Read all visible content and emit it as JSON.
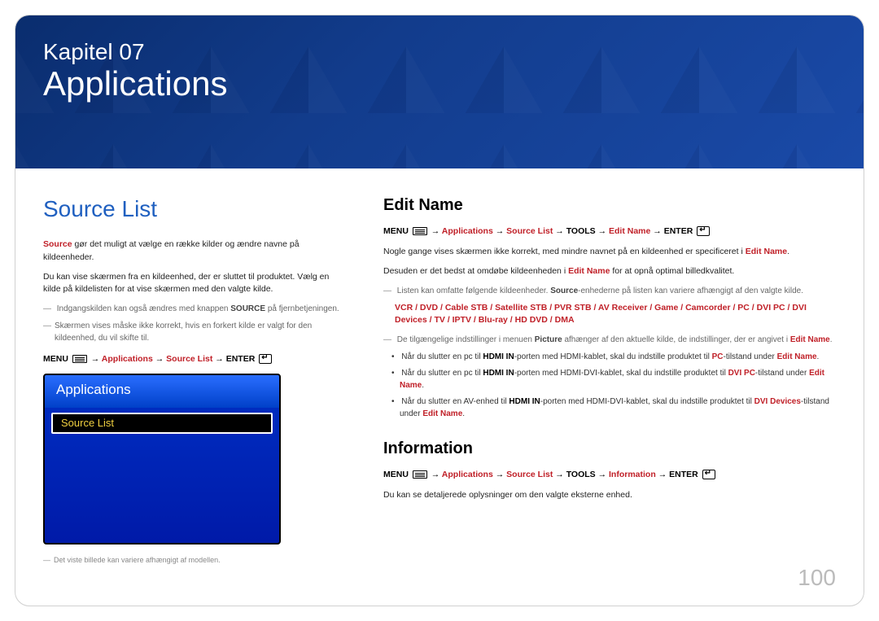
{
  "banner": {
    "chapter": "Kapitel 07",
    "title": "Applications"
  },
  "page_number": "100",
  "left": {
    "heading": "Source List",
    "para1_pre": "Source",
    "para1_rest": " gør det muligt at vælge en række kilder og ændre navne på kildeenheder.",
    "para2": "Du kan vise skærmen fra en kildeenhed, der er sluttet til produktet. Vælg en kilde på kildelisten for at vise skærmen med den valgte kilde.",
    "note1_pre": "Indgangskilden kan også ændres med knappen ",
    "note1_bold": "SOURCE",
    "note1_post": " på fjernbetjeningen.",
    "note2": "Skærmen vises måske ikke korrekt, hvis en forkert kilde er valgt for den kildeenhed, du vil skifte til.",
    "menu_path": {
      "menu": "MENU",
      "applications": "Applications",
      "source_list": "Source List",
      "enter": "ENTER"
    },
    "preview": {
      "header": "Applications",
      "item": "Source List"
    },
    "footnote": "Det viste billede kan variere afhængigt af modellen."
  },
  "right": {
    "edit": {
      "heading": "Edit Name",
      "menu_path": {
        "menu": "MENU",
        "applications": "Applications",
        "source_list": "Source List",
        "tools": "TOOLS",
        "edit_name": "Edit Name",
        "enter": "ENTER"
      },
      "para1_pre": "Nogle gange vises skærmen ikke korrekt, med mindre navnet på en kildeenhed er specificeret i ",
      "para1_red": "Edit Name",
      "para1_post": ".",
      "para2_pre": "Desuden er det bedst at omdøbe kildeenheden i ",
      "para2_red": "Edit Name",
      "para2_post": " for at opnå optimal billedkvalitet.",
      "note1_pre": "Listen kan omfatte følgende kildeenheder. ",
      "note1_bold": "Source",
      "note1_post": "-enhederne på listen kan variere afhængigt af den valgte kilde.",
      "device_list": "VCR / DVD / Cable STB / Satellite STB / PVR STB / AV Receiver / Game / Camcorder / PC / DVI PC / DVI Devices / TV / IPTV / Blu-ray / HD DVD / DMA",
      "note2_pre": "De tilgængelige indstillinger i menuen ",
      "note2_b1": "Picture",
      "note2_mid": " afhænger af den aktuelle kilde, de indstillinger, der er angivet i ",
      "note2_red": "Edit Name",
      "note2_post": ".",
      "bullets": [
        {
          "pre": "Når du slutter en pc til ",
          "b1": "HDMI IN",
          "mid": "-porten med HDMI-kablet, skal du indstille produktet til ",
          "r1": "PC",
          "mid2": "-tilstand under ",
          "r2": "Edit Name",
          "post": "."
        },
        {
          "pre": "Når du slutter en pc til ",
          "b1": "HDMI IN",
          "mid": "-porten med HDMI-DVI-kablet, skal du indstille produktet til ",
          "r1": "DVI PC",
          "mid2": "-tilstand under ",
          "r2": "Edit Name",
          "post": "."
        },
        {
          "pre": "Når du slutter en AV-enhed til ",
          "b1": "HDMI IN",
          "mid": "-porten med HDMI-DVI-kablet, skal du indstille produktet til ",
          "r1": "DVI Devices",
          "mid2": "-tilstand under ",
          "r2": "Edit Name",
          "post": "."
        }
      ]
    },
    "info": {
      "heading": "Information",
      "menu_path": {
        "menu": "MENU",
        "applications": "Applications",
        "source_list": "Source List",
        "tools": "TOOLS",
        "information": "Information",
        "enter": "ENTER"
      },
      "para": "Du kan se detaljerede oplysninger om den valgte eksterne enhed."
    }
  }
}
